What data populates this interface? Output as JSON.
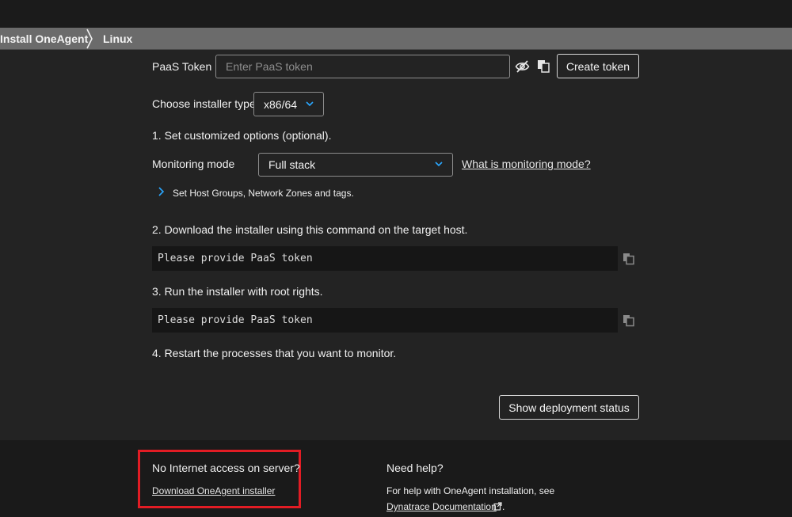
{
  "breadcrumb": {
    "items": [
      "Install OneAgent",
      "Linux"
    ]
  },
  "paas": {
    "label": "PaaS Token",
    "placeholder": "Enter PaaS token",
    "create_label": "Create token",
    "icons": [
      "eye-off-icon",
      "copy-icon"
    ]
  },
  "installer": {
    "label": "Choose installer type:",
    "selected": "x86/64"
  },
  "step1": {
    "title": "1. Set customized options (optional).",
    "monitoring_label": "Monitoring mode",
    "monitoring_selected": "Full stack",
    "help_link": "What is monitoring mode?",
    "expander_label": "Set Host Groups, Network Zones and tags."
  },
  "step2": {
    "title": "2. Download the installer using this command on the target host.",
    "code": "Please provide PaaS token"
  },
  "step3": {
    "title": "3. Run the installer with root rights.",
    "code": "Please provide PaaS token"
  },
  "step4": {
    "title": "4. Restart the processes that you want to monitor."
  },
  "deployment": {
    "button_label": "Show deployment status"
  },
  "footer": {
    "offline_title": "No Internet access on server?",
    "offline_link": "Download OneAgent installer",
    "help_title": "Need help?",
    "help_text": "For help with OneAgent installation, see",
    "help_link": "Dynatrace Documentation",
    "help_suffix": "."
  },
  "colors": {
    "accent": "#1496ff",
    "highlight": "#e21c24",
    "background": "#232323"
  }
}
